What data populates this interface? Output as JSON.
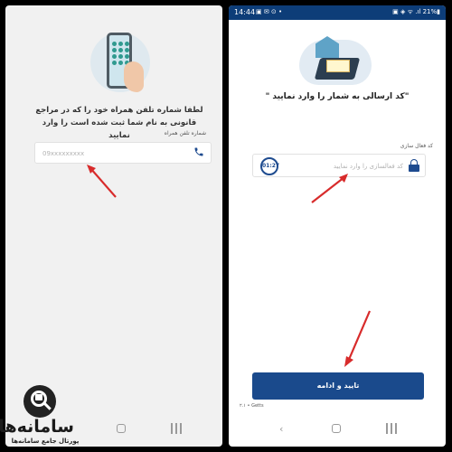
{
  "left_screen": {
    "instruction": "لطفا شماره تلفن همراه خود را که در مراجع قانونی به نام شما ثبت شده است را وارد نمایید",
    "field_label": "شماره تلفن همراه",
    "phone_placeholder": "09xxxxxxxxx",
    "phone_icon": "phone-icon"
  },
  "right_screen": {
    "status": {
      "time": "14:44",
      "icons": "▣ ✉ ⊙ •",
      "right": "▣ ◈ ᯤ .ıl 21%▮"
    },
    "title": "\"کد ارسالی به شمار        را وارد نمایید \"",
    "field_label": "کد فعال سازی",
    "code_placeholder": "کد فعالسازی را وارد نمایید",
    "timer": "01:27",
    "submit_label": "تایید و ادامه",
    "version": "۲.۱ • Getts"
  },
  "logo": {
    "brand": "سامانه‌ها",
    "tagline": "پورتال جامع سامانه‌ها"
  },
  "colors": {
    "accent": "#1a4a8c",
    "statusbar": "#0d3d78",
    "arrow": "#d82b2b"
  }
}
